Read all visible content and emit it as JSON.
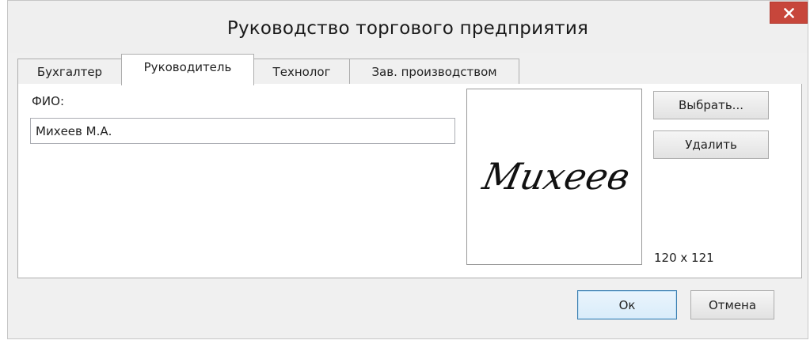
{
  "window": {
    "title": "Руководство торгового предприятия",
    "close_label": "×"
  },
  "tabs": [
    {
      "label": "Бухгалтер",
      "active": false
    },
    {
      "label": "Руководитель",
      "active": true
    },
    {
      "label": "Технолог",
      "active": false
    },
    {
      "label": "Зав. производством",
      "active": false
    }
  ],
  "form": {
    "fio_label": "ФИО:",
    "fio_value": "Михеев М.А.",
    "signature_text": "Михеев",
    "choose_button": "Выбрать...",
    "delete_button": "Удалить",
    "image_size": "120 x 121"
  },
  "footer": {
    "ok_button": "Ок",
    "cancel_button": "Отмена"
  },
  "colors": {
    "close_button": "#c7463b",
    "window_bg": "#f0f0f0",
    "panel_bg": "#ffffff",
    "ok_border": "#3c7fb1"
  },
  "icons": {
    "close": "close-icon"
  }
}
